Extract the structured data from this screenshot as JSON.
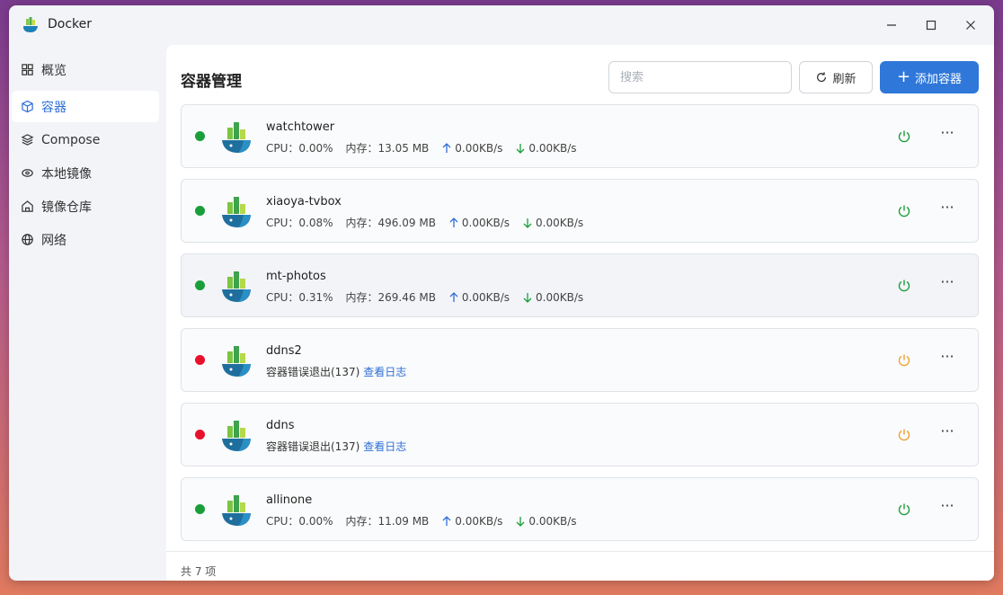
{
  "window": {
    "title": "Docker"
  },
  "sidebar": {
    "items": [
      {
        "label": "概览",
        "icon": "grid-icon",
        "active": false
      },
      {
        "label": "容器",
        "icon": "cube-icon",
        "active": true
      },
      {
        "label": "Compose",
        "icon": "layers-icon",
        "active": false
      },
      {
        "label": "本地镜像",
        "icon": "disk-icon",
        "active": false
      },
      {
        "label": "镜像仓库",
        "icon": "home-icon",
        "active": false
      },
      {
        "label": "网络",
        "icon": "globe-icon",
        "active": false
      }
    ]
  },
  "main": {
    "title": "容器管理",
    "search_placeholder": "搜索",
    "refresh_label": "刷新",
    "add_label": "添加容器"
  },
  "containers": [
    {
      "name": "watchtower",
      "status": "running",
      "cpu": "CPU：0.00%",
      "mem": "内存：13.05 MB",
      "up": "0.00KB/s",
      "down": "0.00KB/s"
    },
    {
      "name": "xiaoya-tvbox",
      "status": "running",
      "cpu": "CPU：0.08%",
      "mem": "内存：496.09 MB",
      "up": "0.00KB/s",
      "down": "0.00KB/s"
    },
    {
      "name": "mt-photos",
      "status": "running",
      "cpu": "CPU：0.31%",
      "mem": "内存：269.46 MB",
      "up": "0.00KB/s",
      "down": "0.00KB/s"
    },
    {
      "name": "ddns2",
      "status": "stopped",
      "error": "容器错误退出(137)",
      "log_link": "查看日志"
    },
    {
      "name": "ddns",
      "status": "stopped",
      "error": "容器错误退出(137)",
      "log_link": "查看日志"
    },
    {
      "name": "allinone",
      "status": "running",
      "cpu": "CPU：0.00%",
      "mem": "内存：11.09 MB",
      "up": "0.00KB/s",
      "down": "0.00KB/s"
    }
  ],
  "footer": {
    "total": "共 7 项"
  },
  "colors": {
    "accent": "#2f77d9",
    "running": "#1a9e3a",
    "stopped": "#e8112d",
    "power_running": "#1a9e3a",
    "power_stopped": "#f0a030"
  }
}
